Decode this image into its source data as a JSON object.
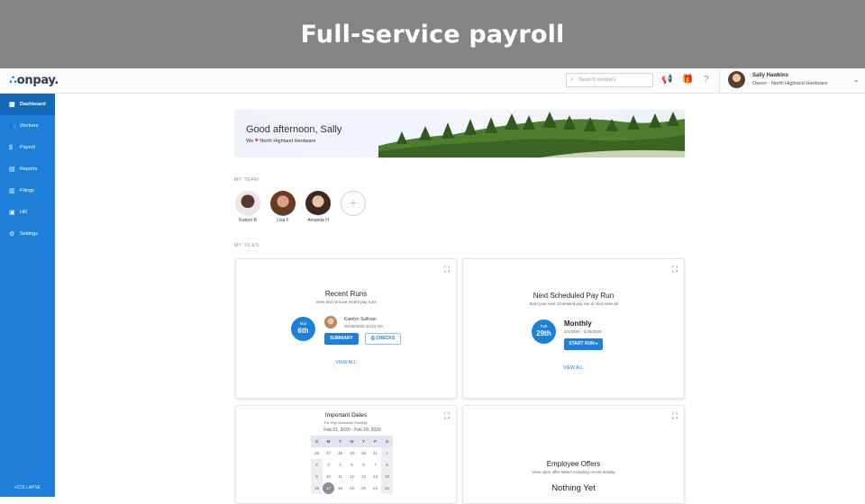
{
  "banner": {
    "title": "Full-service payroll"
  },
  "topbar": {
    "logo": "onpay.",
    "search_placeholder": "Search workers",
    "user_name": "Sally Hawkins",
    "user_company": "Owner - North Highland Hardware"
  },
  "sidebar": {
    "items": [
      {
        "label": "Dashboard",
        "icon": "dashboard-icon"
      },
      {
        "label": "Workers",
        "icon": "workers-icon"
      },
      {
        "label": "Payroll",
        "icon": "payroll-icon"
      },
      {
        "label": "Reports",
        "icon": "reports-icon"
      },
      {
        "label": "Filings",
        "icon": "filings-icon"
      },
      {
        "label": "HR",
        "icon": "hr-icon"
      },
      {
        "label": "Settings",
        "icon": "settings-icon"
      }
    ],
    "collapse_label": "«COLLAPSE"
  },
  "hero": {
    "greeting": "Good afternoon, Sally",
    "we": "We",
    "company": "North Highland Hardware"
  },
  "team": {
    "label": "MY TEAM",
    "members": [
      "Robert B",
      "Lisa F",
      "Amanda H"
    ]
  },
  "tiles": {
    "label": "MY TILES",
    "recent_runs": {
      "title": "Recent Runs",
      "subtitle": "View and remove recent pay runs",
      "badge_month": "Mar",
      "badge_day": "6th",
      "person": "Katelyn Sullivan",
      "datetime": "02/28/2020 10:24 AM",
      "summary_label": "SUMMARY",
      "checks_label": "CHECKS",
      "view_all": "VIEW ALL"
    },
    "next_run": {
      "title": "Next Scheduled Pay Run",
      "subtitle": "Start your next scheduled pay run or click view all",
      "badge_month": "Feb",
      "badge_day": "29th",
      "frequency": "Monthly",
      "period": "2/1/2020 - 2/29/2020",
      "start_label": "START RUN ▸",
      "view_all": "VIEW ALL"
    },
    "important_dates": {
      "title": "Important Dates",
      "subtitle": "For Pay Schedule 'Monthly'",
      "range": "Feb 01, 2020 - Feb 29, 2020",
      "dow": [
        "S",
        "M",
        "T",
        "W",
        "T",
        "F",
        "S"
      ],
      "weeks": [
        [
          "26",
          "27",
          "28",
          "29",
          "30",
          "31",
          "1"
        ],
        [
          "2",
          "3",
          "4",
          "5",
          "6",
          "7",
          "8"
        ],
        [
          "9",
          "10",
          "11",
          "12",
          "13",
          "14",
          "15"
        ],
        [
          "16",
          "17",
          "18",
          "19",
          "20",
          "21",
          "22"
        ]
      ]
    },
    "offers": {
      "title": "Employee Offers",
      "subtitle": "View open offer letters including recent activity",
      "empty": "Nothing Yet"
    }
  }
}
